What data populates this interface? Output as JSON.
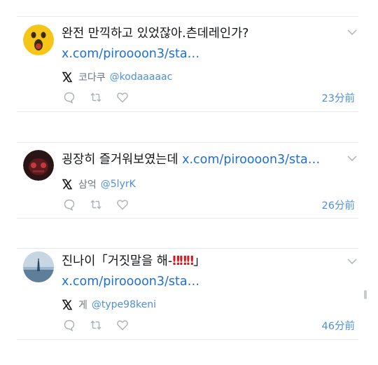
{
  "tweets": [
    {
      "text": "완전 만끽하고 있었잖아.츤데레인가?",
      "link": "x.com/piroooon3/sta…",
      "name": "코다쿠",
      "handle": "@kodaaaaac",
      "time": "23分前",
      "avatar_icon": "shocked-face-emoji-avatar"
    },
    {
      "text": "굉장히 즐거워보였는데",
      "link": "x.com/piroooon3/sta…",
      "name": "삼억",
      "handle": "@5lyrK",
      "time": "26分前",
      "avatar_icon": "dark-red-avatar"
    },
    {
      "text": "진나이「거짓말을 해-",
      "emphasis": "‼‼‼",
      "text_close": "」",
      "link": "x.com/piroooon3/sta…",
      "name": "게",
      "handle": "@type98keni",
      "time": "46分前",
      "avatar_icon": "sea-photo-avatar"
    }
  ],
  "colors": {
    "link": "#1d6fd8",
    "handle": "#4f8fd6",
    "divider": "#e6e9ec",
    "emphasis": "#e0161b"
  }
}
